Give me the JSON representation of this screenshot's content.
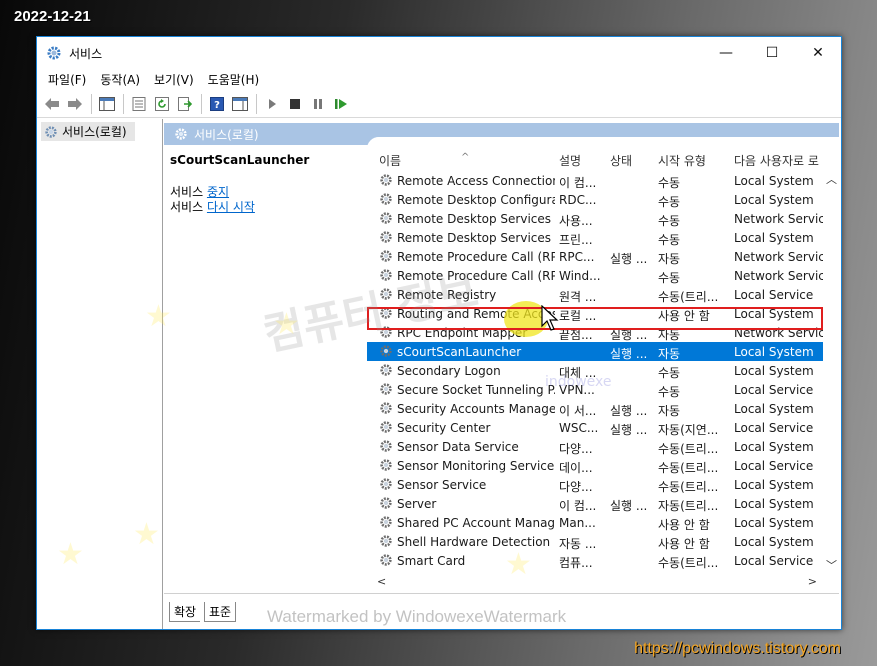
{
  "overlay": {
    "date": "2022-12-21",
    "site": "https://pcwindows.tistory.com",
    "site_color": "#f5a623",
    "watermark_korean": "컴퓨터 정보",
    "watermark_domain": "indowexe",
    "watermark_bottom": "Watermarked by WindowexeWatermark"
  },
  "window": {
    "title": "서비스",
    "app_icon": "gear-icon",
    "controls": {
      "minimize": "—",
      "maximize": "☐",
      "close": "✕"
    }
  },
  "menu": [
    "파일(F)",
    "동작(A)",
    "보기(V)",
    "도움말(H)"
  ],
  "tree": {
    "root": "서비스(로컬)"
  },
  "header": {
    "title": "서비스(로컬)"
  },
  "detail": {
    "service_name": "sCourtScanLauncher",
    "stop_prefix": "서비스 ",
    "stop_link": "중지",
    "restart_prefix": "서비스 ",
    "restart_link": "다시 시작"
  },
  "columns": {
    "name": "이름",
    "description": "설명",
    "status": "상태",
    "startup": "시작 유형",
    "logon": "다음 사용자로 로"
  },
  "services": [
    {
      "name": "Remote Access Connection...",
      "desc": "이 컴...",
      "status": "",
      "startup": "수동",
      "logon": "Local System"
    },
    {
      "name": "Remote Desktop Configura...",
      "desc": "RDC...",
      "status": "",
      "startup": "수동",
      "logon": "Local System"
    },
    {
      "name": "Remote Desktop Services",
      "desc": "사용...",
      "status": "",
      "startup": "수동",
      "logon": "Network Service"
    },
    {
      "name": "Remote Desktop Services ...",
      "desc": "프린...",
      "status": "",
      "startup": "수동",
      "logon": "Local System"
    },
    {
      "name": "Remote Procedure Call (RP...",
      "desc": "RPC...",
      "status": "실행 ...",
      "startup": "자동",
      "logon": "Network Service"
    },
    {
      "name": "Remote Procedure Call (RP...",
      "desc": "Wind...",
      "status": "",
      "startup": "수동",
      "logon": "Network Service"
    },
    {
      "name": "Remote Registry",
      "desc": "원격 ...",
      "status": "",
      "startup": "수동(트리...",
      "logon": "Local Service"
    },
    {
      "name": "Routing and Remote Access",
      "desc": "로컬 ...",
      "status": "",
      "startup": "사용 안 함",
      "logon": "Local System"
    },
    {
      "name": "RPC Endpoint Mapper",
      "desc": "끝점...",
      "status": "실행 ...",
      "startup": "자동",
      "logon": "Network Service"
    },
    {
      "name": "sCourtScanLauncher",
      "desc": "",
      "status": "실행 ...",
      "startup": "자동",
      "logon": "Local System",
      "selected": true
    },
    {
      "name": "Secondary Logon",
      "desc": "대체 ...",
      "status": "",
      "startup": "수동",
      "logon": "Local System"
    },
    {
      "name": "Secure Socket Tunneling P...",
      "desc": "VPN...",
      "status": "",
      "startup": "수동",
      "logon": "Local Service"
    },
    {
      "name": "Security Accounts Manager",
      "desc": "이 서...",
      "status": "실행 ...",
      "startup": "자동",
      "logon": "Local System"
    },
    {
      "name": "Security Center",
      "desc": "WSC...",
      "status": "실행 ...",
      "startup": "자동(지연...",
      "logon": "Local Service"
    },
    {
      "name": "Sensor Data Service",
      "desc": "다양...",
      "status": "",
      "startup": "수동(트리...",
      "logon": "Local System"
    },
    {
      "name": "Sensor Monitoring Service",
      "desc": "데이...",
      "status": "",
      "startup": "수동(트리...",
      "logon": "Local Service"
    },
    {
      "name": "Sensor Service",
      "desc": "다양...",
      "status": "",
      "startup": "수동(트리...",
      "logon": "Local System"
    },
    {
      "name": "Server",
      "desc": "이 컴...",
      "status": "실행 ...",
      "startup": "자동(트리...",
      "logon": "Local System"
    },
    {
      "name": "Shared PC Account Manager",
      "desc": "Man...",
      "status": "",
      "startup": "사용 안 함",
      "logon": "Local System"
    },
    {
      "name": "Shell Hardware Detection",
      "desc": "자동 ...",
      "status": "",
      "startup": "사용 안 함",
      "logon": "Local System"
    },
    {
      "name": "Smart Card",
      "desc": "컴퓨...",
      "status": "",
      "startup": "수동(트리...",
      "logon": "Local Service"
    }
  ],
  "tabs": [
    "확장",
    "표준"
  ],
  "colors": {
    "selection": "#0078d7",
    "outline": "#e01e1e",
    "header_band": "#a9c4e4",
    "link": "#0066cc"
  }
}
